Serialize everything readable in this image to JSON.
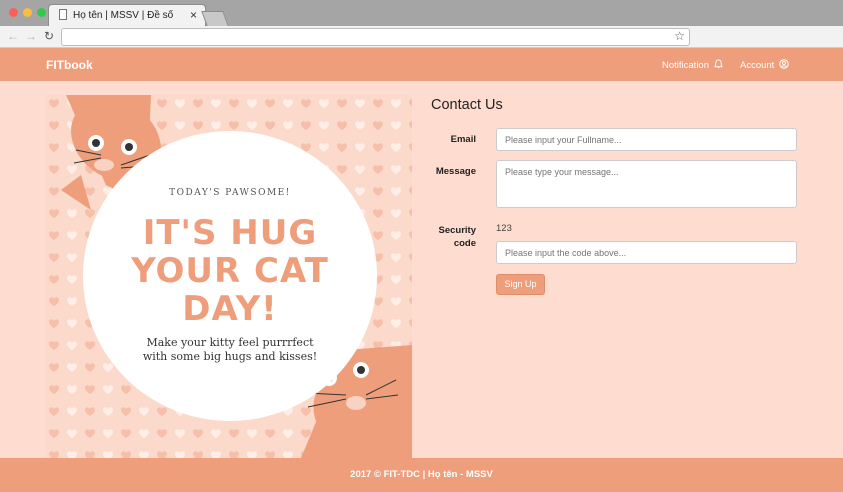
{
  "browser": {
    "tab_title": "Họ tên | MSSV | Đề số",
    "tab_close": "×",
    "back": "←",
    "forward": "→",
    "reload": "↻",
    "url": "",
    "bookmark": "☆",
    "colors": {
      "close": "#fc605c",
      "minimize": "#fdbc40",
      "maximize": "#34c84a"
    }
  },
  "navbar": {
    "brand": "FITbook",
    "notification_label": "Notification",
    "notification_icon": "bell-icon",
    "account_label": "Account",
    "account_icon": "user-circle-icon"
  },
  "poster": {
    "small": "TODAY'S PAWSOME!",
    "big_lines": [
      "IT'S HUG",
      "YOUR CAT",
      "DAY!"
    ],
    "sub_lines": [
      "Make your kitty feel purrrfect",
      "with some big hugs and kisses!"
    ]
  },
  "form": {
    "title": "Contact Us",
    "email_label": "Email",
    "email_placeholder": "Please input your Fullname...",
    "message_label": "Message",
    "message_placeholder": "Please type your message...",
    "security_label_1": "Security",
    "security_label_2": "code",
    "security_code": "123",
    "code_placeholder": "Please input the code above...",
    "submit": "Sign Up"
  },
  "footer": {
    "text": "2017 © FIT-TDC | Họ tên - MSSV"
  },
  "colors": {
    "accent": "#ee9e7b",
    "background": "#fedcd0"
  }
}
